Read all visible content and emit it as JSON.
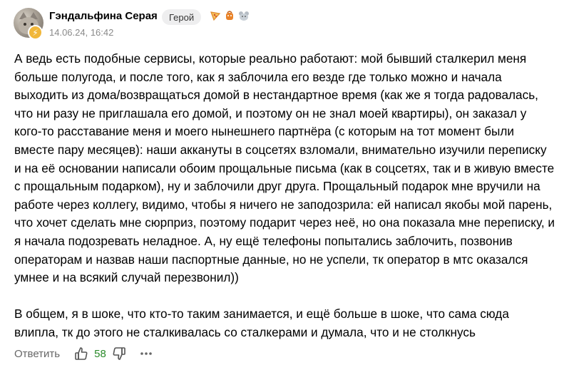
{
  "comment": {
    "author": "Гэндальфина Серая",
    "role": "Герой",
    "timestamp": "14.06.24, 16:42",
    "avatar_icon": "cat-avatar",
    "badge_icon": "lightning-icon",
    "badge_color": "#f1b73a",
    "achievements": [
      {
        "icon": "pizza-slice-icon"
      },
      {
        "icon": "orange-bag-icon"
      },
      {
        "icon": "gray-mouse-icon"
      }
    ],
    "paragraphs": [
      "А ведь есть подобные сервисы, которые реально работают: мой бывший сталкерил меня больше полугода, и после того, как я заблочила его везде где только можно и начала выходить из дома/возвращаться домой в нестандартное время (как же я тогда радовалась, что ни разу не приглашала его домой, и поэтому он не знал моей квартиры), он заказал у кого-то расставание меня и моего нынешнего партнёра (с которым на тот момент были вместе пару месяцев): наши аккануты в соцсетях взломали, внимательно изучили переписку и на её основании написали обоим прощальные письма (как в соцсетях, так и в живую вместе с прощальным подарком), ну и заблочили друг друга. Прощальный подарок мне вручили на работе через коллегу, видимо, чтобы я ничего не заподозрила: ей написал якобы мой парень, что хочет сделать мне сюрприз, поэтому подарит через неё, но она показала мне переписку, и я начала подозревать неладное. А, ну ещё телефоны попытались заблочить, позвонив операторам и назвав наши паспортные данные, но не успели, тк оператор в мтс оказался умнее и на всякий случай перезвонил))",
      "В общем, я в шоке, что кто-то таким занимается, и ещё больше в шоке, что сама сюда влипла, тк до этого не сталкивалась со сталкерами и думала, что и не столкнусь"
    ]
  },
  "footer": {
    "reply_label": "Ответить",
    "like_count": "58",
    "like_count_color": "#2a8a2a"
  }
}
